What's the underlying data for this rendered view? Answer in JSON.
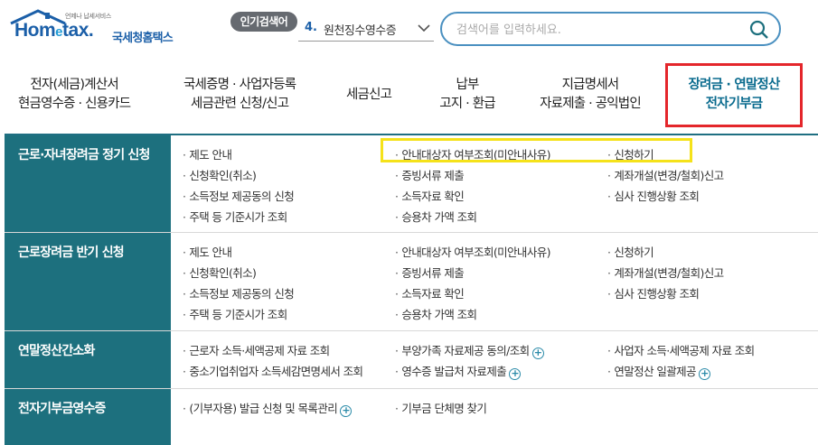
{
  "header": {
    "logo_tagline": "언제나 납세서비스",
    "logo_word_a": "Hom",
    "logo_word_e": "e",
    "logo_word_b": "tax.",
    "logo_korean": "국세청홈택스",
    "popular_label": "인기검색어",
    "popular_number": "4.",
    "popular_text": "원천징수영수증",
    "search_placeholder": "검색어를 입력하세요."
  },
  "nav": [
    {
      "line1": "전자(세금)계산서",
      "line2": "현금영수증 · 신용카드"
    },
    {
      "line1": "국세증명 · 사업자등록",
      "line2": "세금관련 신청/신고"
    },
    {
      "line1": "세금신고",
      "line2": ""
    },
    {
      "line1": "납부",
      "line2": "고지 · 환급"
    },
    {
      "line1": "지급명세서",
      "line2": "자료제출 · 공익법인"
    },
    {
      "line1": "장려금 · 연말정산",
      "line2": "전자기부금"
    }
  ],
  "sections": [
    {
      "title": "근로·자녀장려금 정기 신청",
      "col1": [
        "제도 안내",
        "신청확인(취소)",
        "소득정보 제공동의 신청",
        "주택 등 기준시가 조회"
      ],
      "col2": [
        "안내대상자 여부조회(미안내사유)",
        "증빙서류 제출",
        "소득자료 확인",
        "승용차 가액 조회"
      ],
      "col3": [
        "신청하기",
        "계좌개설(변경/철회)신고",
        "심사 진행상황 조회"
      ]
    },
    {
      "title": "근로장려금 반기 신청",
      "col1": [
        "제도 안내",
        "신청확인(취소)",
        "소득정보 제공동의 신청",
        "주택 등 기준시가 조회"
      ],
      "col2": [
        "안내대상자 여부조회(미안내사유)",
        "증빙서류 제출",
        "소득자료 확인",
        "승용차 가액 조회"
      ],
      "col3": [
        "신청하기",
        "계좌개설(변경/철회)신고",
        "심사 진행상황 조회"
      ]
    },
    {
      "title": "연말정산간소화",
      "col1": [
        "근로자 소득·세액공제 자료 조회",
        "중소기업취업자 소득세감면명세서 조회"
      ],
      "col2": [
        "부양가족 자료제공 동의/조회",
        "영수증 발급처 자료제출"
      ],
      "col3": [
        "사업자 소득·세액공제 자료 조회",
        "연말정산 일괄제공"
      ]
    },
    {
      "title": "전자기부금영수증",
      "col1": [
        "(기부자용) 발급 신청 및 목록관리"
      ],
      "col2": [
        "기부금 단체명 찾기"
      ],
      "col3": []
    }
  ],
  "plus_symbol": "+",
  "colors": {
    "brand": "#1b5fa8",
    "section_head": "#1d707e",
    "active_nav": "#0a6b8e",
    "red_box": "#e4262b",
    "yellow_box": "#f5e21a"
  }
}
